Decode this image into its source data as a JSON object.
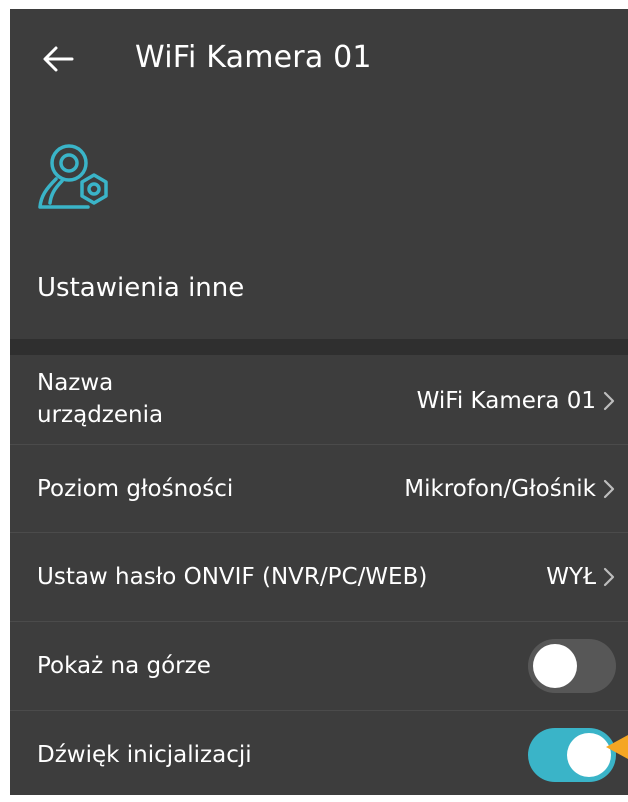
{
  "header": {
    "title": "WiFi Kamera 01"
  },
  "section": {
    "title": "Ustawienia inne"
  },
  "icons": {
    "back": "arrow-left-icon",
    "settings": "camera-gear-icon",
    "chevron": "chevron-right-icon"
  },
  "colors": {
    "background": "#3d3d3d",
    "accent": "#3ab4c8",
    "toggle_off": "#575757",
    "pointer": "#f5a623"
  },
  "rows": [
    {
      "label": "Nazwa urządzenia",
      "value": "WiFi Kamera 01",
      "type": "link"
    },
    {
      "label": "Poziom głośności",
      "value": "Mikrofon/Głośnik",
      "type": "link"
    },
    {
      "label": "Ustaw hasło ONVIF (NVR/PC/WEB)",
      "value": "WYŁ",
      "type": "link"
    },
    {
      "label": "Pokaż na górze",
      "state": "off",
      "type": "toggle"
    },
    {
      "label": "Dźwięk inicjalizacji",
      "state": "on",
      "type": "toggle"
    }
  ]
}
